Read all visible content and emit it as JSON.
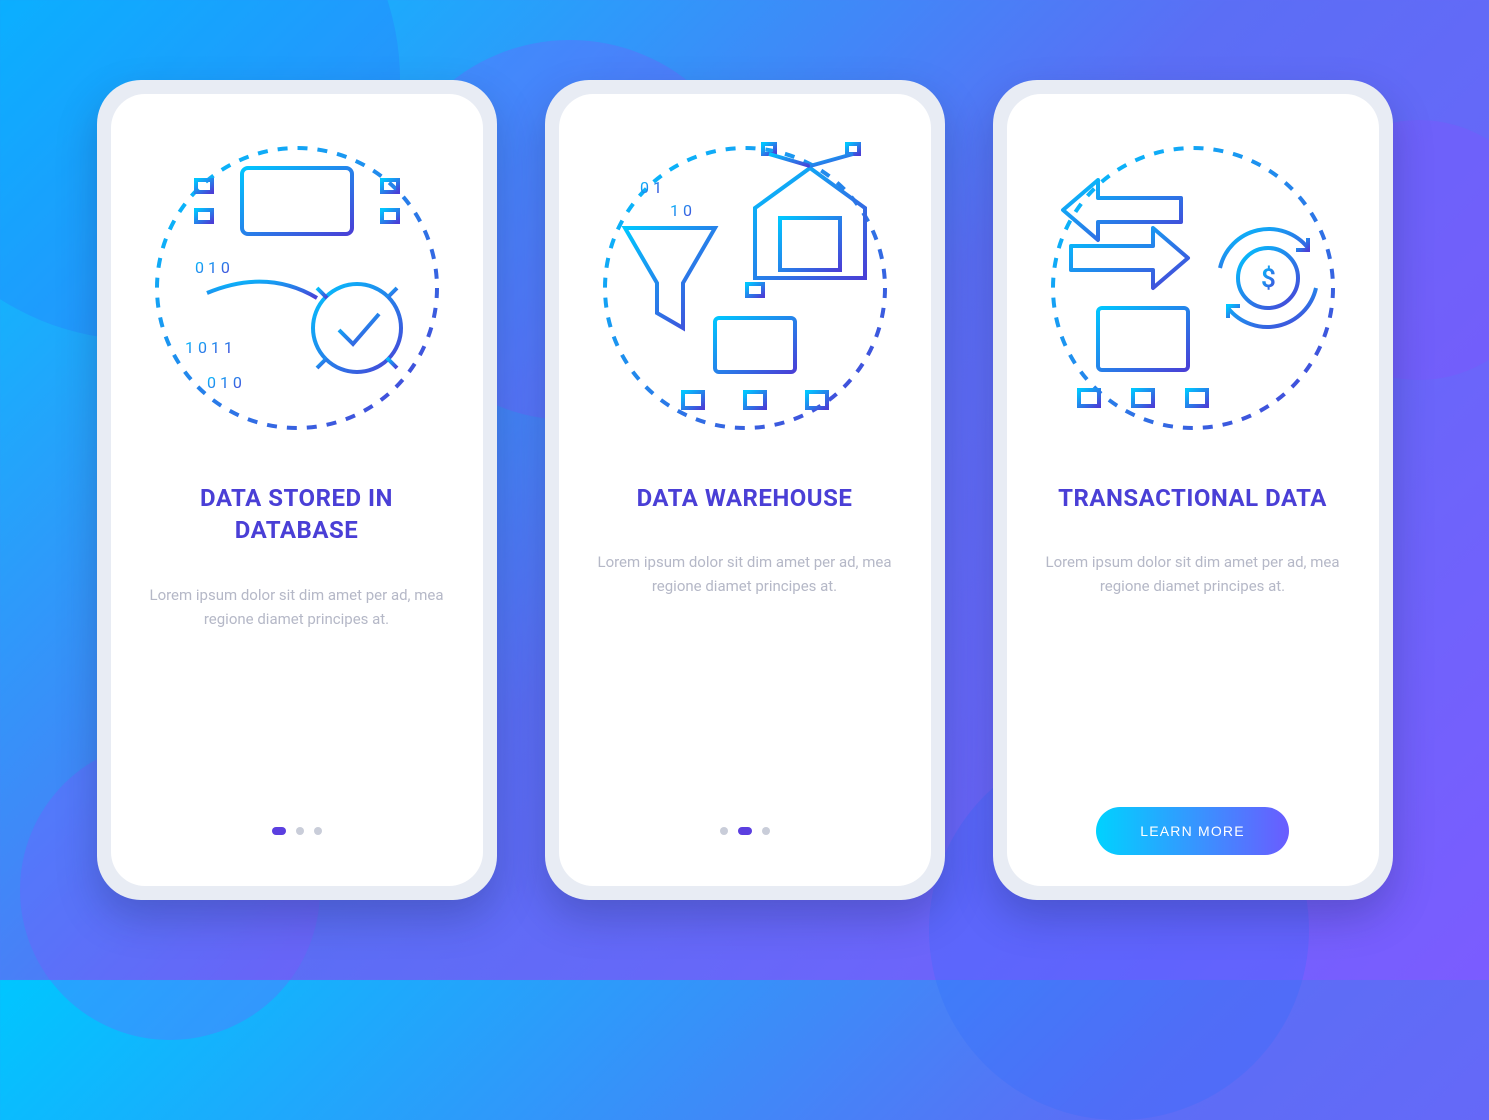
{
  "screens": [
    {
      "title": "DATA STORED IN DATABASE",
      "body": "Lorem ipsum dolor sit dim amet per ad, mea regione diamet principes at.",
      "icon_name": "database-mining-icon",
      "active_dot": 0,
      "footer": "dots"
    },
    {
      "title": "DATA WAREHOUSE",
      "body": "Lorem ipsum dolor sit dim amet per ad, mea regione diamet principes at.",
      "icon_name": "data-warehouse-icon",
      "active_dot": 1,
      "footer": "dots"
    },
    {
      "title": "TRANSACTIONAL DATA",
      "body": "Lorem ipsum dolor sit dim amet per ad, mea regione diamet principes at.",
      "icon_name": "transactional-data-icon",
      "active_dot": 2,
      "footer": "cta"
    }
  ],
  "cta_label": "LEARN MORE",
  "colors": {
    "grad_start": "#00c6ff",
    "grad_end": "#4a3fd6",
    "title": "#4a3fd6",
    "body": "#b5b8c7"
  }
}
